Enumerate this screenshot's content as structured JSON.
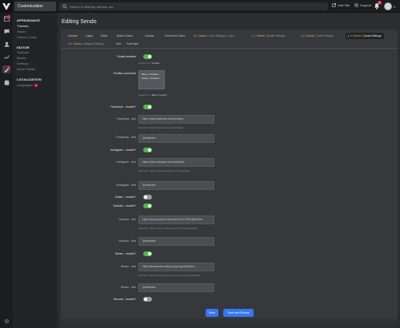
{
  "topbar": {
    "app_title": "Customization",
    "search_placeholder": "Search in settings, sendos, etc",
    "visit_site": "Visit Site",
    "support": "Support",
    "notification_count": "2"
  },
  "sidebar": {
    "appearance_heading": "APPEARANCE",
    "appearance_items": [
      "Themes",
      "Sendo",
      "Clicks & Links"
    ],
    "editor_heading": "EDITOR",
    "editor_items": [
      "Toolbars",
      "Blocks",
      "Settings",
      "Block Palette"
    ],
    "localization_heading": "LOCALIZATION",
    "localization_items": [
      "Languages"
    ]
  },
  "page": {
    "title": "Editing Sendo"
  },
  "tabs": {
    "row1": [
      {
        "pre": "",
        "main": "General",
        "hl": "",
        "post": ""
      },
      {
        "pre": "",
        "main": "Logos",
        "hl": "",
        "post": ""
      },
      {
        "pre": "",
        "main": "Editor",
        "hl": "",
        "post": ""
      },
      {
        "pre": "",
        "main": "Button Colors",
        "hl": "",
        "post": ""
      },
      {
        "pre": "",
        "main": "Custom",
        "hl": "",
        "post": ""
      },
      {
        "pre": "",
        "main": "Front-End Colors",
        "hl": "",
        "post": ""
      },
      {
        "pre": "(⊕ | ",
        "main": "",
        "hl": "Sendo",
        "post": " | Color Settings | Logo )"
      },
      {
        "pre": "( ⊡ | ",
        "main": "",
        "hl": "Sendo",
        "post": " | Border Settings"
      },
      {
        "pre": "( ⊟ | ",
        "main": "",
        "hl": "Sendo",
        "post": " | Color Settings"
      },
      {
        "pre": "( ↗ | ",
        "main": "",
        "hl": "Sendo",
        "post": " | Social Settings"
      }
    ],
    "row2": [
      {
        "pre": "( ⊞ | ",
        "main": "",
        "hl": "Sendo",
        "post": " | Widgets Settings"
      },
      {
        "pre": "",
        "main": "Text",
        "hl": "",
        "post": ""
      },
      {
        "pre": "",
        "main": "Font Style",
        "hl": "",
        "post": ""
      }
    ]
  },
  "form": {
    "social_enabled_label": "Social enabled",
    "social_enabled_hint_prefix": "Defaults to",
    "social_enabled_hint_value": "\"enable\"",
    "position_label": "Position social list",
    "position_options": [
      "Menu / Position",
      "Footer / Position"
    ],
    "position_hint_prefix": "Defaults to",
    "position_hint_value": "\"Menu, Footer\"",
    "facebook_enabled_label": "Facebook - enable?",
    "facebook_link_label": "Facebook - link",
    "facebook_link_value": "https://www.facebook.com/sebbkdev",
    "facebook_link_hint": "Example: https://facebook.com/sebbkdev",
    "facebook_title_label": "Facebook - title",
    "facebook_title_value": "@sebbkdev",
    "instagram_enabled_label": "Instagram - enable?",
    "instagram_link_label": "Instagram - link",
    "instagram_link_value": "https://www.instagram.com/sebbkdev",
    "instagram_link_hint": "Example: https://www.instagram.com/sebbkdev",
    "instagram_title_label": "Instagram - title",
    "instagram_title_value": "@sebbkdev",
    "twitter_enabled_label": "Twitter - enable?",
    "youtube_enabled_label": "Youtube - enable?",
    "youtube_link_label": "Youtube - link",
    "youtube_link_value": "https://www.youtube.com/channel/UCVbR1qiMMWnx",
    "youtube_link_hint": "Example: https://www.youtube.com/channel/sebbkdev",
    "youtube_title_label": "Youtube - title",
    "youtube_title_value": "@sebbkdev",
    "steam_enabled_label": "Steam - enable?",
    "steam_link_label": "Steam - link",
    "steam_link_value": "https://steamcommunity.com/groups/sebbkdev",
    "steam_link_hint": "Example: https://steamcommunity.com/groups/sebbkdev",
    "steam_title_label": "Steam - title",
    "steam_title_value": "@sebbkdev",
    "discord_enabled_label": "Discord - enable?"
  },
  "buttons": {
    "save": "Save",
    "save_reload": "Save and Reload"
  },
  "colors": {
    "accent": "#3478f6",
    "toggle_on": "#4fb84f",
    "highlight": "#f0b429",
    "badge": "#e0334c"
  }
}
